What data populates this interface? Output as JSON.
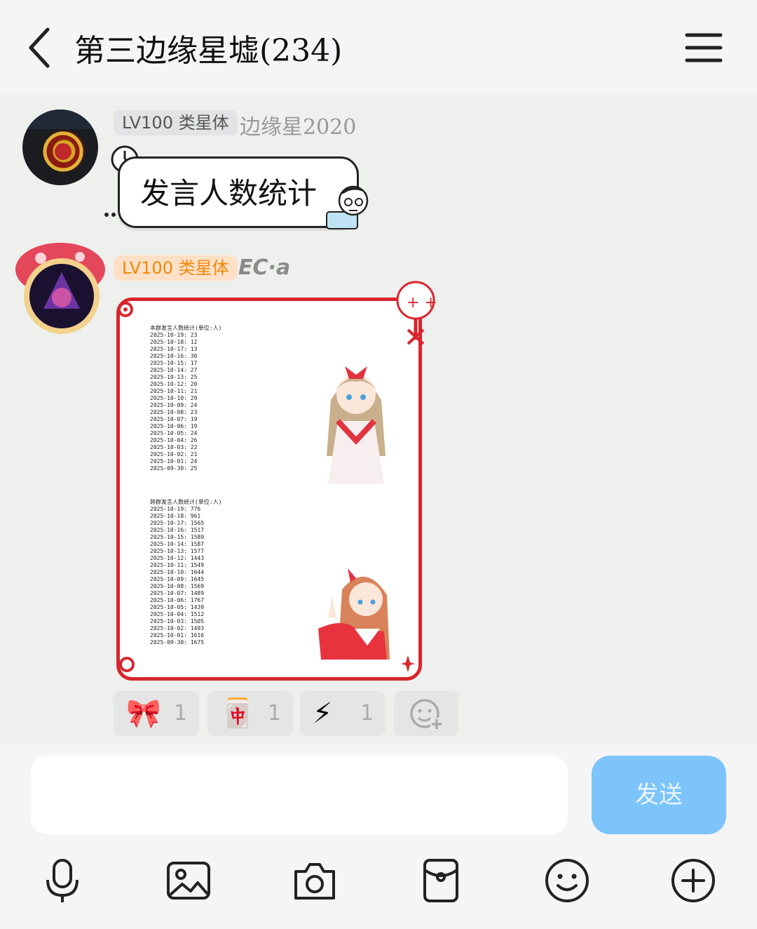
{
  "header": {
    "title": "第三边缘星墟(234)"
  },
  "messages": [
    {
      "badge": "LV100 类星体",
      "sender": "边缘星2020",
      "text": "发言人数统计"
    },
    {
      "badge": "LV100 类星体",
      "sender": "EC·a",
      "image": {
        "section1": {
          "title": "本群发言人数统计(单位:人)",
          "lines": [
            "2025-10-19: 23",
            "2025-10-18: 12",
            "2025-10-17: 13",
            "2025-10-16: 30",
            "2025-10-15: 17",
            "2025-10-14: 27",
            "2025-10-13: 25",
            "2025-10-12: 20",
            "2025-10-11: 21",
            "2025-10-10: 29",
            "2025-10-09: 24",
            "2025-10-08: 23",
            "2025-10-07: 19",
            "2025-10-06: 19",
            "2025-10-05: 24",
            "2025-10-04: 26",
            "2025-10-03: 22",
            "2025-10-02: 21",
            "2025-10-01: 24",
            "2025-09-30: 25"
          ]
        },
        "section2": {
          "title": "跨群发言人数统计(单位:人)",
          "lines": [
            "2025-10-19: 776",
            "2025-10-18: 961",
            "2025-10-17: 1565",
            "2025-10-16: 1517",
            "2025-10-15: 1589",
            "2025-10-14: 1587",
            "2025-10-13: 1577",
            "2025-10-12: 1443",
            "2025-10-11: 1549",
            "2025-10-10: 1644",
            "2025-10-09: 1645",
            "2025-10-08: 1569",
            "2025-10-07: 1489",
            "2025-10-06: 1767",
            "2025-10-05: 1439",
            "2025-10-04: 1512",
            "2025-10-03: 1505",
            "2025-10-02: 1493",
            "2025-10-01: 1616",
            "2025-09-30: 1675"
          ]
        }
      }
    }
  ],
  "reactions": [
    {
      "emoji": "🎀",
      "count": "1"
    },
    {
      "emoji": "🀄",
      "count": "1"
    },
    {
      "emoji": "⚡",
      "count": "1"
    }
  ],
  "input": {
    "value": "",
    "send_label": "发送"
  },
  "colors": {
    "accent": "#7cc4fb",
    "card_border": "#d8262e",
    "badge_orange": "#f0880a"
  },
  "toolbar_icons": [
    "mic-icon",
    "image-icon",
    "camera-icon",
    "red-packet-icon",
    "emoji-icon",
    "plus-icon"
  ]
}
